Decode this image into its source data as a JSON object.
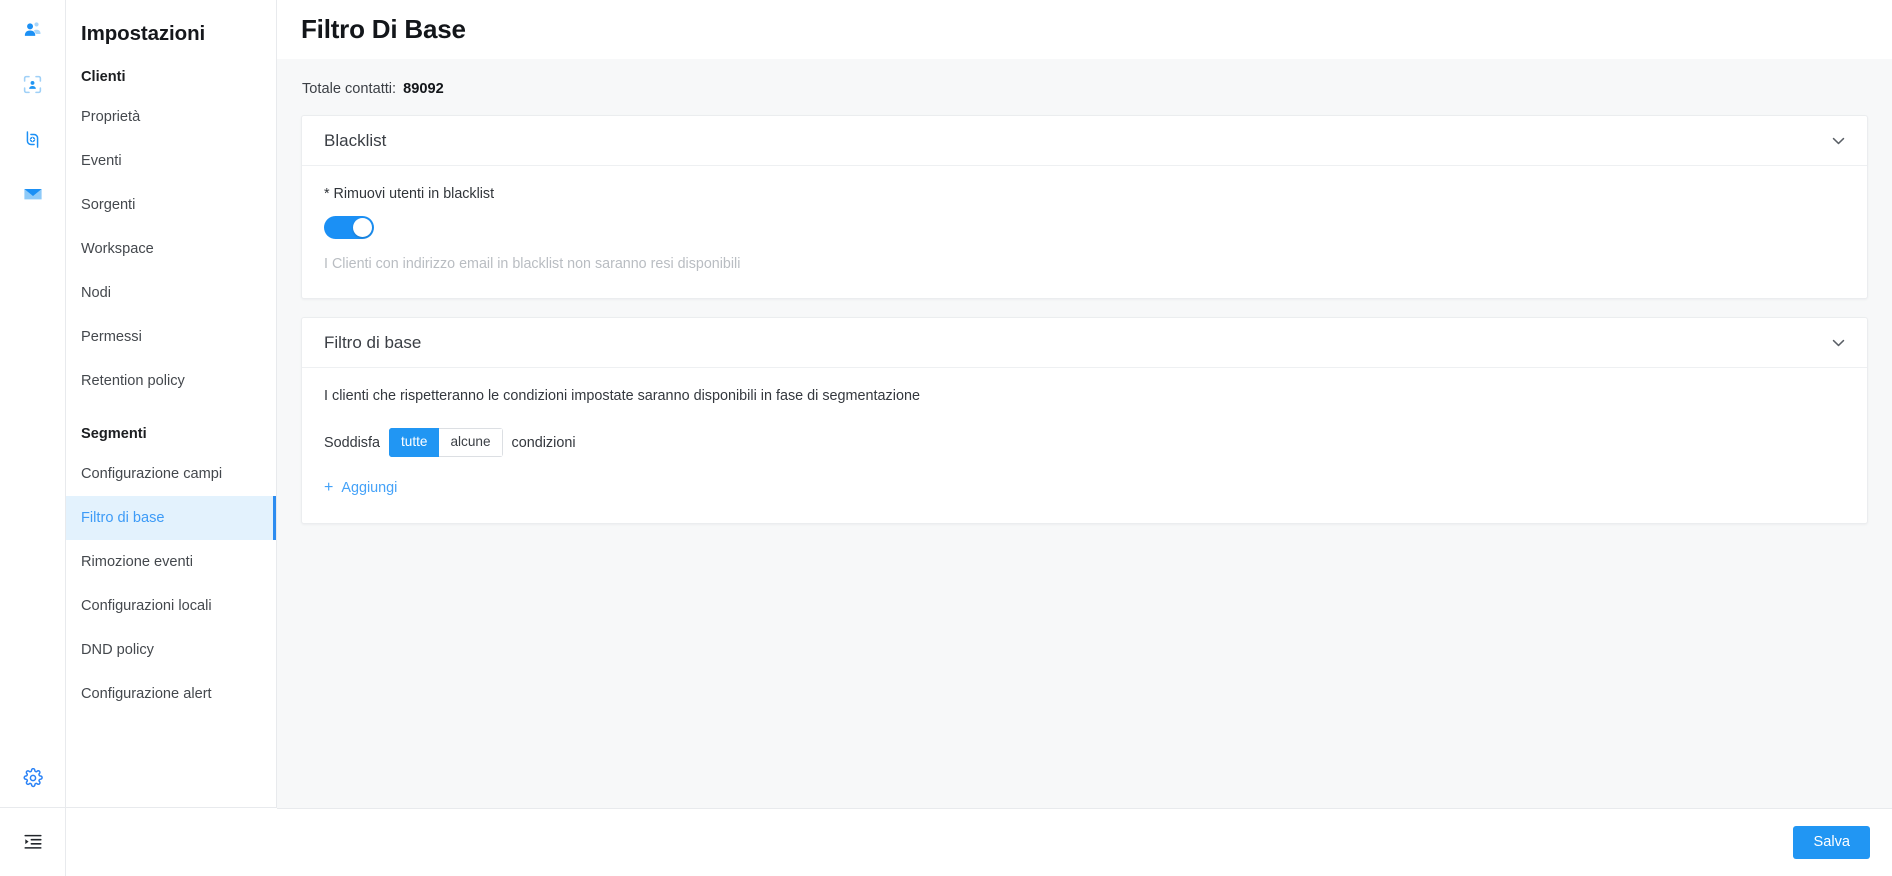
{
  "rail": {
    "top_icons": [
      {
        "name": "contacts-icon",
        "title": "Contatti"
      },
      {
        "name": "audience-scan-icon",
        "title": "Audience"
      },
      {
        "name": "flow-node-icon",
        "title": "Flussi"
      },
      {
        "name": "envelope-icon",
        "title": "Messaggi"
      }
    ],
    "gear_icon": {
      "name": "gear-icon",
      "title": "Impostazioni"
    },
    "collapse_icon": {
      "name": "collapse-sidebar-icon",
      "title": "Comprimi"
    }
  },
  "sidebar": {
    "title": "Impostazioni",
    "groups": [
      {
        "heading": "Clienti",
        "items": [
          {
            "label": "Proprietà",
            "active": false
          },
          {
            "label": "Eventi",
            "active": false
          },
          {
            "label": "Sorgenti",
            "active": false
          },
          {
            "label": "Workspace",
            "active": false
          },
          {
            "label": "Nodi",
            "active": false
          },
          {
            "label": "Permessi",
            "active": false
          },
          {
            "label": "Retention policy",
            "active": false
          }
        ]
      },
      {
        "heading": "Segmenti",
        "items": [
          {
            "label": "Configurazione campi",
            "active": false
          },
          {
            "label": "Filtro di base",
            "active": true
          },
          {
            "label": "Rimozione eventi",
            "active": false
          },
          {
            "label": "Configurazioni locali",
            "active": false
          },
          {
            "label": "DND policy",
            "active": false
          },
          {
            "label": "Configurazione alert",
            "active": false
          }
        ]
      }
    ]
  },
  "header": {
    "title": "Filtro Di Base"
  },
  "totals": {
    "label": "Totale contatti:",
    "value": "89092"
  },
  "cards": {
    "blacklist": {
      "title": "Blacklist",
      "chevron": "⌄",
      "field_label": "* Rimuovi utenti in blacklist",
      "toggle_on": true,
      "hint": "I Clienti con indirizzo email in blacklist non saranno resi disponibili"
    },
    "base_filter": {
      "title": "Filtro di base",
      "chevron": "⌄",
      "description": "I clienti che rispetteranno le condizioni impostate saranno disponibili in fase di segmentazione",
      "condition_prefix": "Soddisfa",
      "condition_suffix": "condizioni",
      "options": [
        {
          "label": "tutte",
          "selected": true
        },
        {
          "label": "alcune",
          "selected": false
        }
      ],
      "add_label": "Aggiungi",
      "add_plus": "+"
    }
  },
  "footer": {
    "save_label": "Salva"
  },
  "colors": {
    "accent": "#2196f3",
    "accent_soft": "#e3f2fd",
    "page_bg": "#f7f8f9",
    "text": "#34383e",
    "muted": "#b9bdc2"
  }
}
